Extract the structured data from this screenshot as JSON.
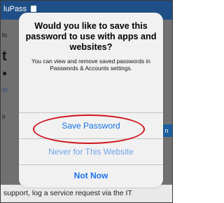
{
  "background": {
    "app_title": "luPass",
    "fragments": [
      "lo",
      "t",
      "ot",
      "ir"
    ],
    "side_button": "n",
    "footer_text": "support, log a service request via the IT"
  },
  "alert": {
    "title": "Would you like to save this password to use with apps and websites?",
    "message": "You can view and remove saved passwords in Passwords & Accounts settings.",
    "buttons": {
      "save": "Save Password",
      "never": "Never for This Website",
      "not_now": "Not Now"
    }
  },
  "colors": {
    "accent": "#1572e8",
    "annotation": "#d0141b",
    "header": "#1f4f86"
  }
}
